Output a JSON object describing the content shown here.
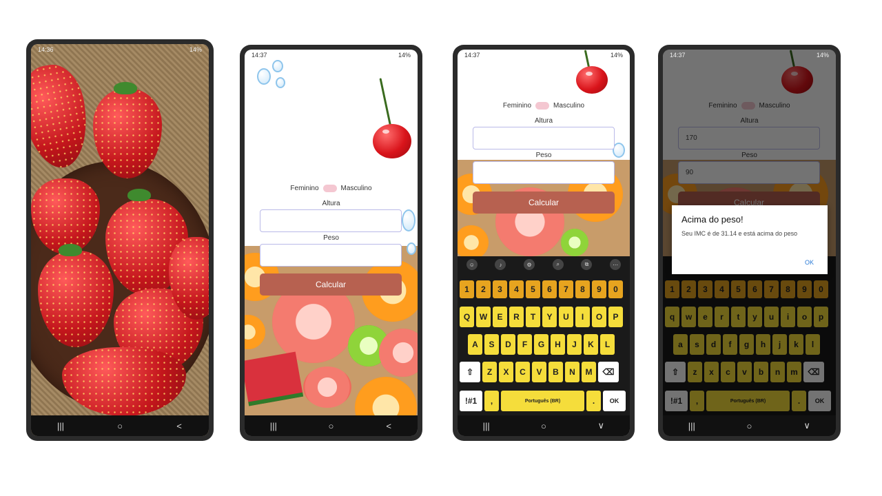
{
  "status": {
    "time_1": "14:36",
    "time": "14:37",
    "battery": "14%"
  },
  "form": {
    "female_label": "Feminino",
    "male_label": "Masculino",
    "height_label": "Altura",
    "weight_label": "Peso",
    "calc_button": "Calcular",
    "height_value": "170",
    "weight_value": "90"
  },
  "keyboard": {
    "numbers": [
      "1",
      "2",
      "3",
      "4",
      "5",
      "6",
      "7",
      "8",
      "9",
      "0"
    ],
    "row1_upper": [
      "Q",
      "W",
      "E",
      "R",
      "T",
      "Y",
      "U",
      "I",
      "O",
      "P"
    ],
    "row2_upper": [
      "A",
      "S",
      "D",
      "F",
      "G",
      "H",
      "J",
      "K",
      "L"
    ],
    "row3_upper": [
      "Z",
      "X",
      "C",
      "V",
      "B",
      "N",
      "M"
    ],
    "row1_lower": [
      "q",
      "w",
      "e",
      "r",
      "t",
      "y",
      "u",
      "i",
      "o",
      "p"
    ],
    "row2_lower": [
      "a",
      "s",
      "d",
      "f",
      "g",
      "h",
      "j",
      "k",
      "l"
    ],
    "row3_lower": [
      "z",
      "x",
      "c",
      "v",
      "b",
      "n",
      "m"
    ],
    "symbols_key": "!#1",
    "comma_key": ",",
    "period_key": ".",
    "space_label": "Português (BR)",
    "ok_key": "OK"
  },
  "dialog": {
    "title": "Acima do peso!",
    "message": "Seu IMC é de 31.14 e está acima do peso",
    "ok": "OK"
  },
  "nav": {
    "recent": "|||",
    "home": "○",
    "back": "<",
    "hide": "∨"
  }
}
